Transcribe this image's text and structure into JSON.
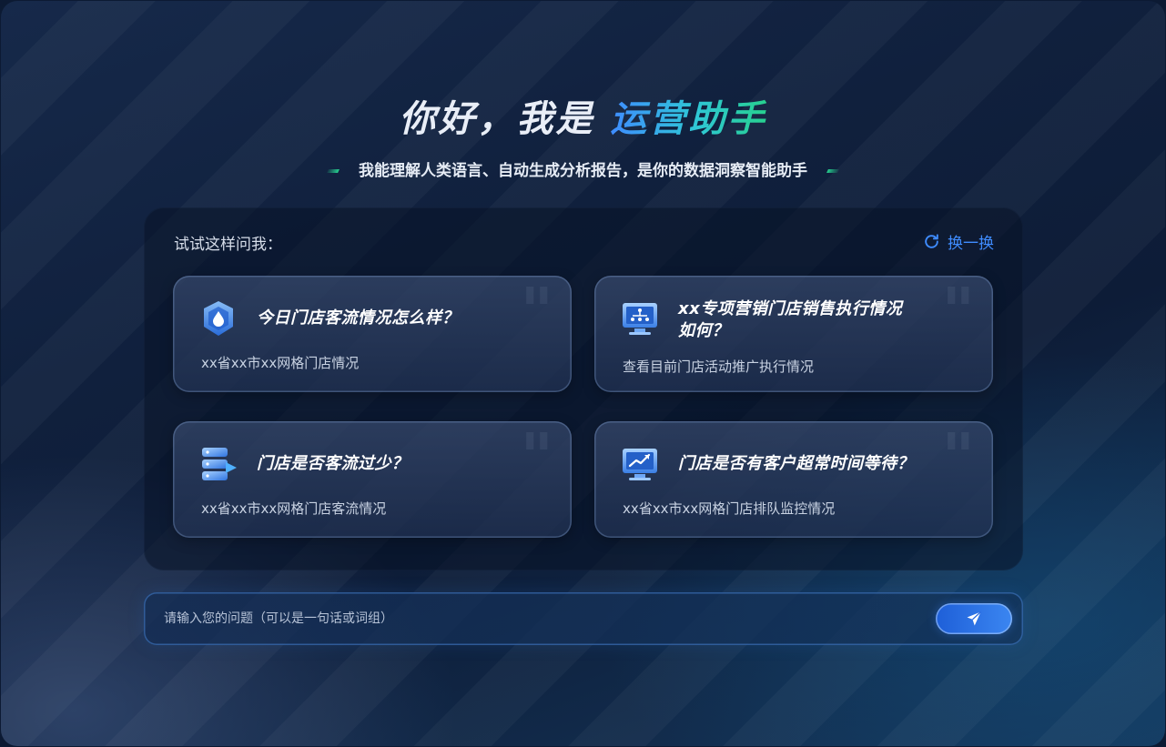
{
  "header": {
    "greeting": "你好，我是 ",
    "assistant_name": "运营助手",
    "subtitle": "我能理解人类语言、自动生成分析报告，是你的数据洞察智能助手"
  },
  "suggestions": {
    "title": "试试这样问我：",
    "refresh_label": "换一换",
    "cards": [
      {
        "question": "今日门店客流情况怎么样？",
        "description": "xx省xx市xx网格门店情况",
        "icon": "shield-droplet-icon"
      },
      {
        "question_line1": "xx专项营销门店销售执行情况",
        "question_line2": "如何？",
        "description": "查看目前门店活动推广执行情况",
        "icon": "monitor-network-icon"
      },
      {
        "question": "门店是否客流过少？",
        "description": "xx省xx市xx网格门店客流情况",
        "icon": "server-stack-icon"
      },
      {
        "question": "门店是否有客户超常时间等待？",
        "description": "xx省xx市xx网格门店排队监控情况",
        "icon": "monitor-trend-icon"
      }
    ]
  },
  "input": {
    "placeholder": "请输入您的问题（可以是一句话或词组）",
    "value": "",
    "send_icon": "paper-plane-icon"
  },
  "colors": {
    "accent": "#3f8cff",
    "accent_green": "#27d08f"
  }
}
